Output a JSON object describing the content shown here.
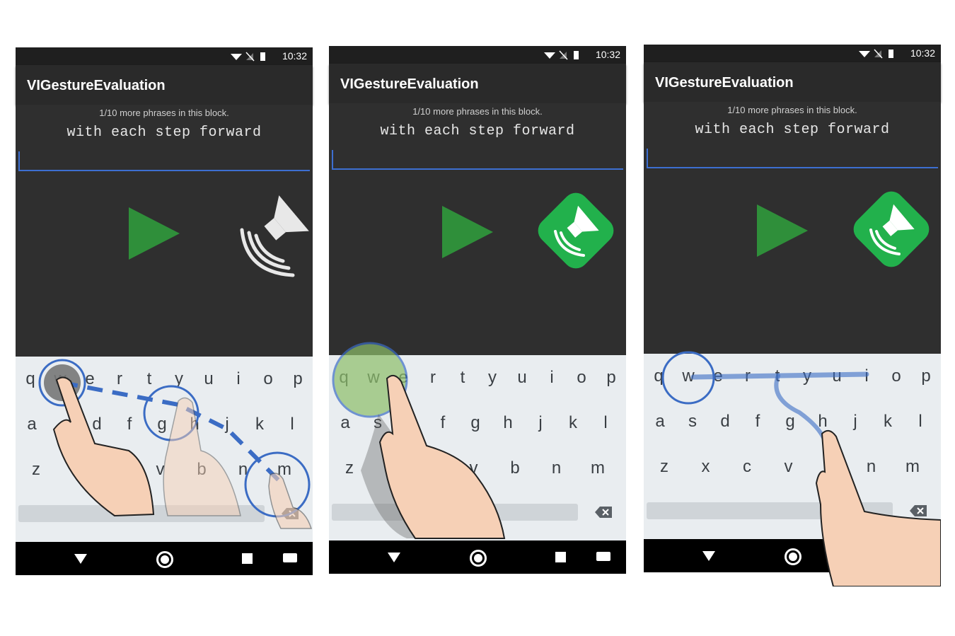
{
  "status": {
    "time": "10:32"
  },
  "app": {
    "title": "VIGestureEvaluation",
    "block_message": "1/10 more phrases in this block.",
    "phrase": "with each step forward"
  },
  "keyboard": {
    "row1": [
      "q",
      "w",
      "e",
      "r",
      "t",
      "y",
      "u",
      "i",
      "o",
      "p"
    ],
    "row2": [
      "a",
      "s",
      "d",
      "f",
      "g",
      "h",
      "j",
      "k",
      "l"
    ],
    "row3": [
      "z",
      "x",
      "c",
      "v",
      "b",
      "n",
      "m"
    ]
  },
  "icons": {
    "play": "play-icon",
    "speaker": "speaker-icon",
    "delete": "backspace-icon",
    "nav_back": "back-triangle-icon",
    "nav_home": "home-circle-icon",
    "nav_recent": "recent-apps-icon",
    "nav_keyboard": "keyboard-icon"
  },
  "colors": {
    "accent_line": "#3d6fd1",
    "play_green": "#2f8f3a",
    "speaker_green": "#22b14c",
    "gesture_blue": "#3b6cc4",
    "highlight_green": "#8dbf6a"
  }
}
